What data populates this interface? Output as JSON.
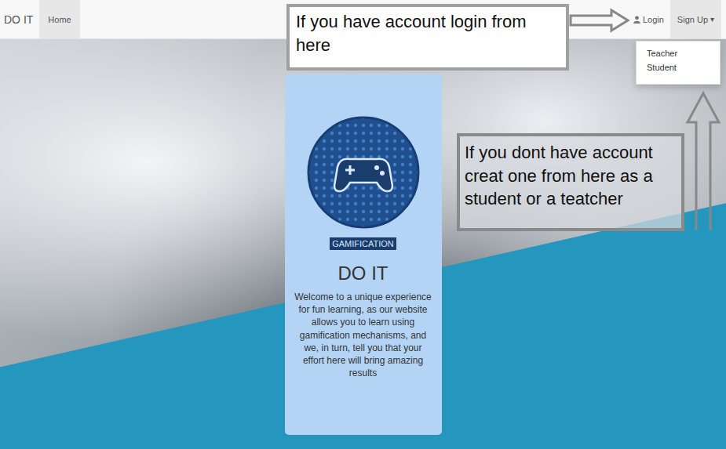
{
  "navbar": {
    "brand": "DO IT",
    "items": [
      {
        "label": "Home",
        "selected": true
      }
    ],
    "login": {
      "label": "Login"
    },
    "signup": {
      "label": "Sign Up",
      "caret": "▾",
      "expanded": true,
      "options": [
        {
          "label": "Teacher",
          "selected": false
        },
        {
          "label": "Student",
          "selected": false
        }
      ]
    }
  },
  "card": {
    "badge": "GAMIFICATION",
    "title": "DO IT",
    "text": "Welcome to a unique experience for fun learning, as our website allows you to learn using gamification mechanisms, and we, in turn, tell you that your effort here will bring amazing results"
  },
  "annotations": [
    {
      "text": "If you have account login from here"
    },
    {
      "text": "If you dont have account creat one from here as a student or a teatcher"
    }
  ]
}
